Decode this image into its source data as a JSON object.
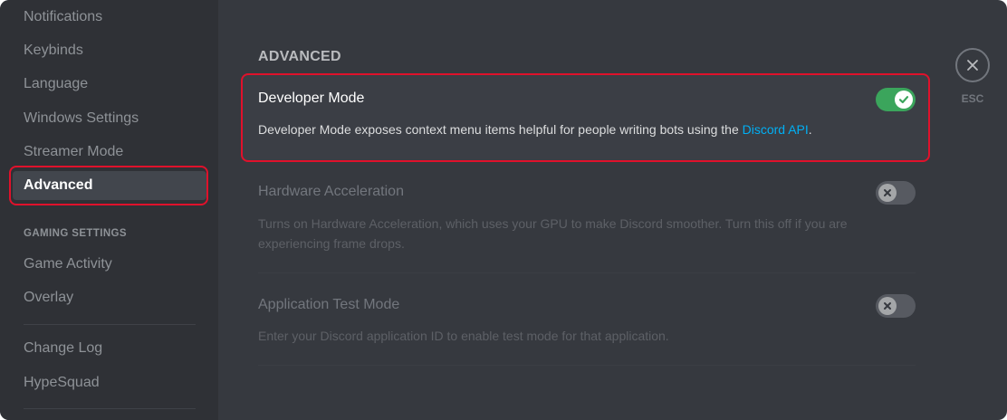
{
  "sidebar": {
    "items": [
      {
        "label": "Notifications"
      },
      {
        "label": "Keybinds"
      },
      {
        "label": "Language"
      },
      {
        "label": "Windows Settings"
      },
      {
        "label": "Streamer Mode"
      },
      {
        "label": "Advanced"
      }
    ],
    "gaming_header": "GAMING SETTINGS",
    "gaming_items": [
      {
        "label": "Game Activity"
      },
      {
        "label": "Overlay"
      }
    ],
    "other_items": [
      {
        "label": "Change Log"
      },
      {
        "label": "HypeSquad"
      }
    ]
  },
  "main": {
    "section_title": "ADVANCED",
    "settings": [
      {
        "title": "Developer Mode",
        "description": "Developer Mode exposes context menu items helpful for people writing bots using the ",
        "link_text": "Discord API",
        "description_end": ".",
        "enabled": true
      },
      {
        "title": "Hardware Acceleration",
        "description": "Turns on Hardware Acceleration, which uses your GPU to make Discord smoother. Turn this off if you are experiencing frame drops.",
        "enabled": false
      },
      {
        "title": "Application Test Mode",
        "description": "Enter your Discord application ID to enable test mode for that application.",
        "enabled": false
      }
    ]
  },
  "close": {
    "label": "ESC"
  },
  "colors": {
    "accent_red": "#e0112b",
    "toggle_on": "#3ba55c",
    "link": "#00aff4"
  },
  "icons": {
    "close": "x-icon",
    "toggle_on": "check-icon",
    "toggle_off": "x-icon"
  }
}
